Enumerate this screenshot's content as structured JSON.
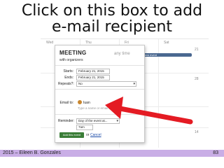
{
  "slide": {
    "title_line1": "Click on this box to add",
    "title_line2": "e-mail recipient"
  },
  "calendar": {
    "day_headers": [
      "Wed",
      "Thu",
      "Fri",
      "Sat"
    ],
    "dates": [
      "21",
      "28",
      "14"
    ],
    "event_label": "New event"
  },
  "popup": {
    "title": "MEETING",
    "time_label": "any time",
    "subtitle": "with organizers",
    "starts_label": "Starts:",
    "starts_value": "February 21, 2015",
    "ends_label": "Ends:",
    "ends_value": "February 21, 2015",
    "repeats_label": "Repeats?:",
    "repeats_value": "No",
    "email_label": "Email to:",
    "recipient_name": "Iuan",
    "email_placeholder": "Type a name or email address",
    "reminder_label": "Reminder:",
    "reminder_value": "Day of the event at...",
    "reminder_time": "7am",
    "add_button": "Add this event",
    "or_text": "or",
    "cancel_link": "Cancel"
  },
  "footer": {
    "left": "2015 – Eileen B. Gonzales",
    "right": "83"
  },
  "colors": {
    "footer_bg": "#c9aee6",
    "arrow": "#e41b23",
    "add_button_bg": "#3a7d37",
    "event_chip": "#4a6890"
  }
}
